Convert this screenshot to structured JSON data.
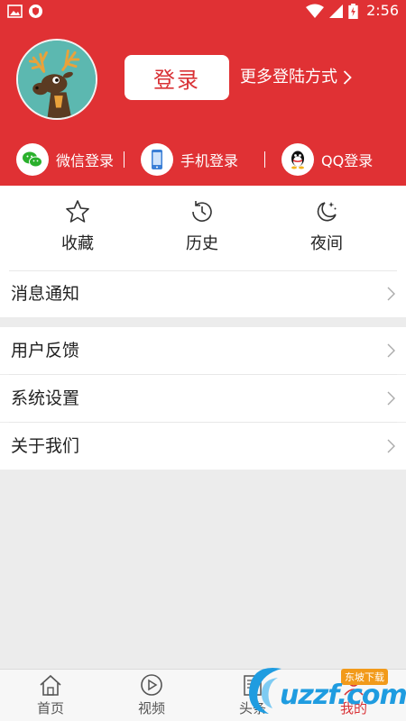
{
  "status_bar": {
    "time": "2:56",
    "icons": [
      "image-icon",
      "shield-icon",
      "wifi-icon",
      "signal-icon",
      "battery-charging-icon"
    ]
  },
  "header": {
    "login_button": "登录",
    "more_login": "更多登陆方式",
    "login_options": [
      {
        "label": "微信登录",
        "icon": "wechat-icon"
      },
      {
        "label": "手机登录",
        "icon": "phone-icon"
      },
      {
        "label": "QQ登录",
        "icon": "qq-icon"
      }
    ]
  },
  "quick_actions": [
    {
      "label": "收藏",
      "icon": "star-icon"
    },
    {
      "label": "历史",
      "icon": "history-icon"
    },
    {
      "label": "夜间",
      "icon": "moon-icon"
    }
  ],
  "menu": {
    "group1": [
      {
        "label": "消息通知"
      }
    ],
    "group2": [
      {
        "label": "用户反馈"
      },
      {
        "label": "系统设置"
      },
      {
        "label": "关于我们"
      }
    ]
  },
  "tabbar": {
    "tabs": [
      {
        "label": "首页",
        "icon": "home-icon",
        "active": false
      },
      {
        "label": "视频",
        "icon": "play-icon",
        "active": false
      },
      {
        "label": "头条",
        "icon": "news-icon",
        "active": false
      },
      {
        "label": "我的",
        "icon": "user-icon",
        "active": true
      }
    ]
  },
  "watermark": {
    "text": "uzzf.com",
    "badge": "东坡下载"
  },
  "colors": {
    "brand_red": "#e03134",
    "background": "#ececec",
    "accent_text": "#d93236"
  }
}
